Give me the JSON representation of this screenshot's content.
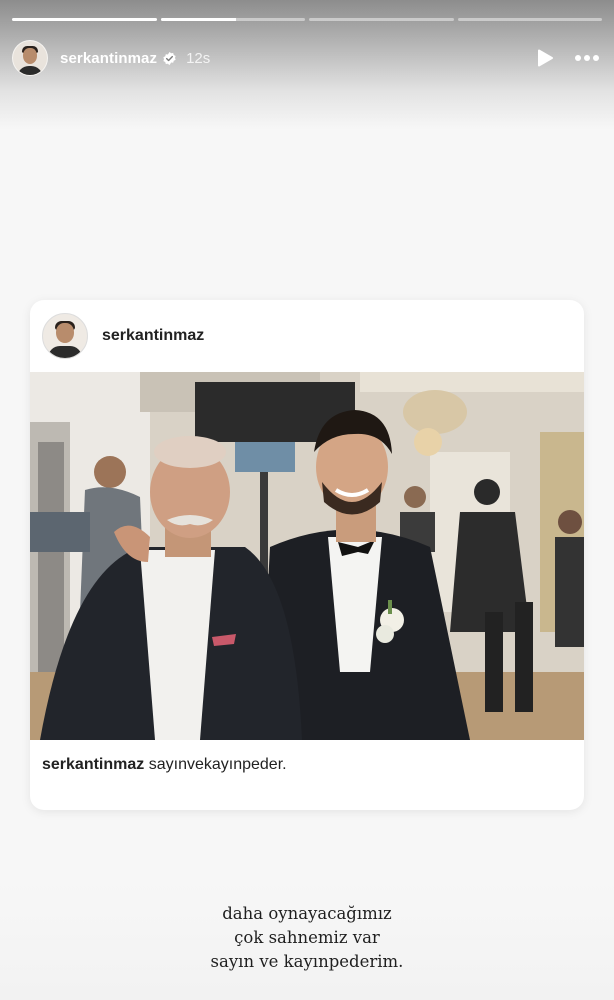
{
  "story": {
    "progress": [
      1,
      0.52,
      0,
      0
    ],
    "username": "serkantinmaz",
    "time": "12s",
    "icons": {
      "verified": "verified-badge-icon",
      "play": "play-icon",
      "more": "more-options-icon"
    }
  },
  "post": {
    "username": "serkantinmaz",
    "caption_user": "serkantinmaz",
    "caption_text": "sayınvekayınpeder."
  },
  "note": {
    "lines": [
      "daha oynayacağımız",
      "çok sahnemiz var",
      "sayın ve kayınpederim."
    ]
  }
}
